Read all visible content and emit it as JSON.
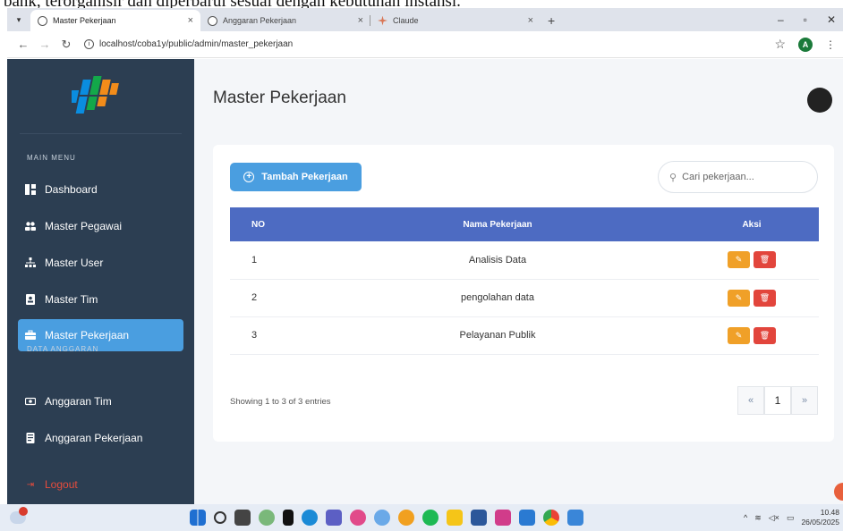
{
  "doc_text": "bank, terorganisir dan diperbarui sesuai dengan kebutuhan instansi.",
  "browser": {
    "tabs": [
      {
        "title": "Master Pekerjaan",
        "active": true,
        "icon": "globe-icon"
      },
      {
        "title": "Anggaran Pekerjaan",
        "active": false,
        "icon": "globe-icon"
      },
      {
        "title": "Claude",
        "active": false,
        "icon": "claude-icon"
      }
    ],
    "url": "localhost/coba1y/public/admin/master_pekerjaan",
    "profile_initial": "A"
  },
  "sidebar": {
    "section_main": "MAIN MENU",
    "section_budget": "DATA ANGGARAN",
    "items": [
      {
        "label": "Dashboard",
        "icon": "dashboard-icon"
      },
      {
        "label": "Master Pegawai",
        "icon": "users-icon"
      },
      {
        "label": "Master User",
        "icon": "sitemap-icon"
      },
      {
        "label": "Master Tim",
        "icon": "id-card-icon"
      },
      {
        "label": "Master Pekerjaan",
        "icon": "briefcase-icon",
        "active": true
      },
      {
        "label": "Anggaran Tim",
        "icon": "money-icon"
      },
      {
        "label": "Anggaran Pekerjaan",
        "icon": "receipt-icon"
      }
    ],
    "logout": "Logout"
  },
  "main": {
    "page_title": "Master Pekerjaan",
    "add_button": "Tambah Pekerjaan",
    "search_placeholder": "Cari pekerjaan...",
    "table": {
      "headers": [
        "NO",
        "Nama Pekerjaan",
        "Aksi"
      ],
      "rows": [
        {
          "no": "1",
          "name": "Analisis Data"
        },
        {
          "no": "2",
          "name": "pengolahan data"
        },
        {
          "no": "3",
          "name": "Pelayanan Publik"
        }
      ]
    },
    "showing": "Showing 1 to 3 of 3 entries",
    "pagination": {
      "prev": "«",
      "current": "1",
      "next": "»"
    }
  },
  "taskbar": {
    "time": "10.48",
    "date": "26/05/2025"
  },
  "colors": {
    "sidebar_bg": "#2c3e52",
    "accent": "#4a9ee0",
    "table_header": "#4d6bc2",
    "edit": "#f0a028",
    "delete": "#e2453c"
  }
}
